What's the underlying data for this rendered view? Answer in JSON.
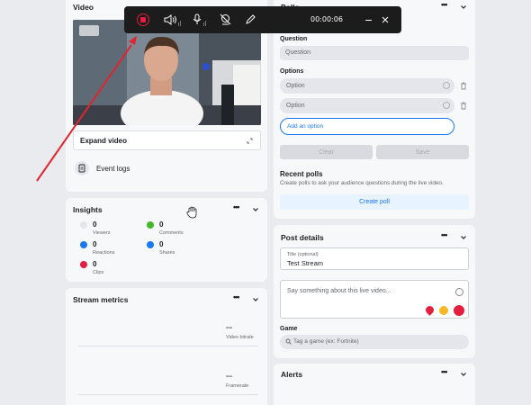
{
  "video_card": {
    "title": "Video",
    "expand_label": "Expand video",
    "event_logs_label": "Event logs"
  },
  "insights": {
    "title": "Insights",
    "stats": [
      {
        "value": "0",
        "label": "Viewers"
      },
      {
        "value": "0",
        "label": "Comments"
      },
      {
        "value": "0",
        "label": "Reactions"
      },
      {
        "value": "0",
        "label": "Shares"
      },
      {
        "value": "0",
        "label": "Clips"
      }
    ]
  },
  "stream_metrics": {
    "title": "Stream metrics",
    "metrics": [
      {
        "value": "---",
        "label": "Video bitrate"
      },
      {
        "value": "---",
        "label": "Framerate"
      }
    ]
  },
  "polls": {
    "title": "Polls",
    "question_label": "Question",
    "question_placeholder": "Question",
    "options_label": "Options",
    "option1_placeholder": "Option",
    "option2_placeholder": "Option",
    "add_option_label": "Add an option",
    "clear_label": "Clear",
    "save_label": "Save",
    "recent_title": "Recent polls",
    "recent_desc": "Create polls to ask your audience questions during the live video.",
    "create_label": "Create poll"
  },
  "post_details": {
    "title": "Post details",
    "title_field_label": "Title (optional)",
    "title_field_value": "Test Stream",
    "description_placeholder": "Say something about this live video...",
    "game_label": "Game",
    "game_placeholder": "Tag a game (ex: Fortnite)"
  },
  "alerts": {
    "title": "Alerts"
  },
  "recorder": {
    "timer": "00:00:06"
  },
  "colors": {
    "accent": "#1877f2",
    "record_red": "#e41e3f",
    "toolbar_bg": "#1c1c1c"
  }
}
